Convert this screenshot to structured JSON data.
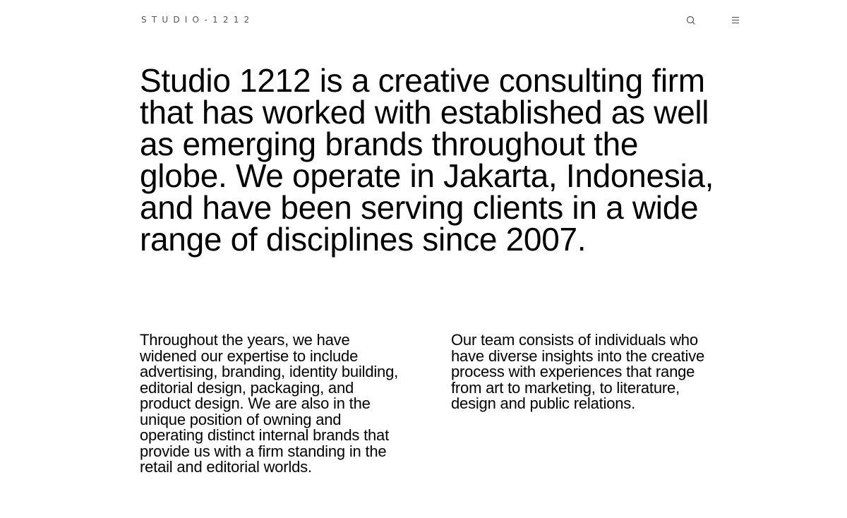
{
  "header": {
    "logo_text": "STUDIO-1212",
    "search_icon": "search-icon",
    "menu_icon": "hamburger-menu-icon"
  },
  "hero": {
    "text": "Studio 1212 is a creative consulting firm that has worked with established as well as emerging brands throughout the globe. We operate in Jakarta, Indonesia, and have been serving clients in a wide range of disciplines since 2007."
  },
  "about": {
    "left_paragraph": "Throughout the years, we have widened our expertise to include advertising, branding, identity building, editorial design, packaging, and product design. We are also in the unique position of owning and operating distinct internal brands that provide us with a firm standing in the retail and editorial worlds.",
    "right_paragraph": "Our team consists of individuals who have diverse insights into the creative process with experiences that range from art to marketing, to literature, design and public relations."
  },
  "colors": {
    "background": "#ffffff",
    "text": "#000000",
    "muted": "#555555"
  }
}
